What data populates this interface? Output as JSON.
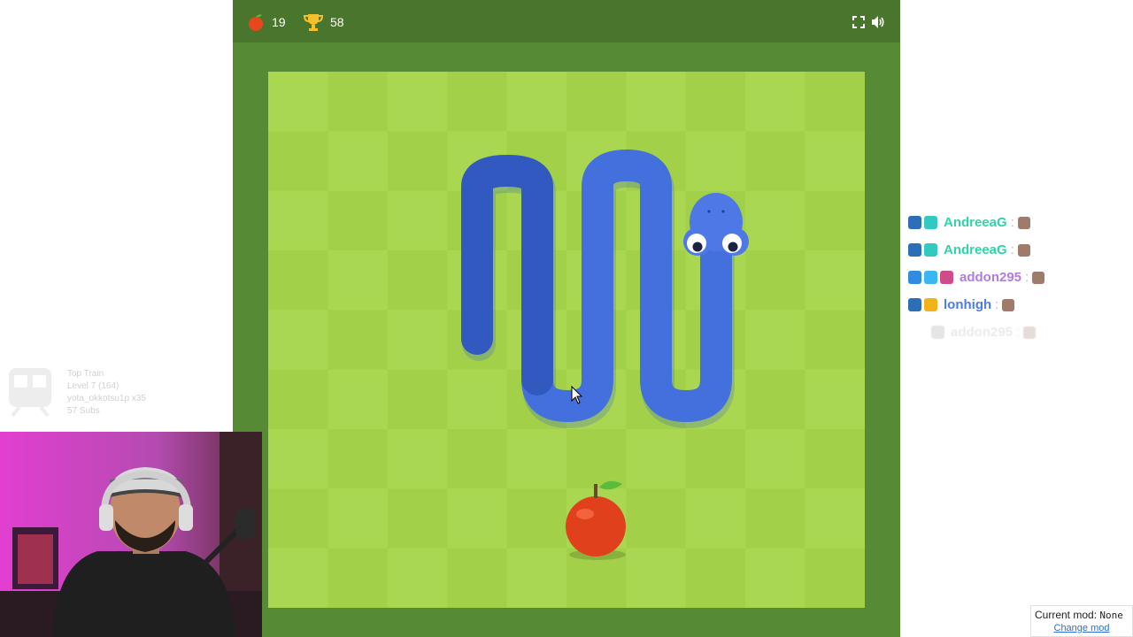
{
  "hud": {
    "apples": "19",
    "high_score": "58",
    "apple_icon": "apple-icon",
    "trophy_icon": "trophy-icon",
    "fullscreen_icon": "fullscreen-icon",
    "sound_icon": "sound-icon"
  },
  "colors": {
    "hud": "#4a752c",
    "frame": "#578a34",
    "tile_light": "#aad751",
    "tile_dark": "#a2d149",
    "snake": "#4a70e0",
    "apple": "#e7471d"
  },
  "chat": {
    "messages": [
      {
        "user": "AndreeaG",
        "sep": ":",
        "color": "#32d3a8"
      },
      {
        "user": "AndreeaG",
        "sep": ":",
        "color": "#32d3a8"
      },
      {
        "user": "addon295",
        "sep": ":",
        "color": "#b47adf"
      },
      {
        "user": "lonhigh",
        "sep": ":",
        "color": "#4d7ce6"
      },
      {
        "user": "addon295",
        "sep": ":",
        "color": "#aaaaaa"
      }
    ]
  },
  "train": {
    "title": "Top Train",
    "level": "Level 7  (164)",
    "user": "yota_okkotsu1p x35",
    "subs": "57 Subs"
  },
  "mod": {
    "label": "Current mod:",
    "value": "None",
    "change": "Change mod"
  }
}
